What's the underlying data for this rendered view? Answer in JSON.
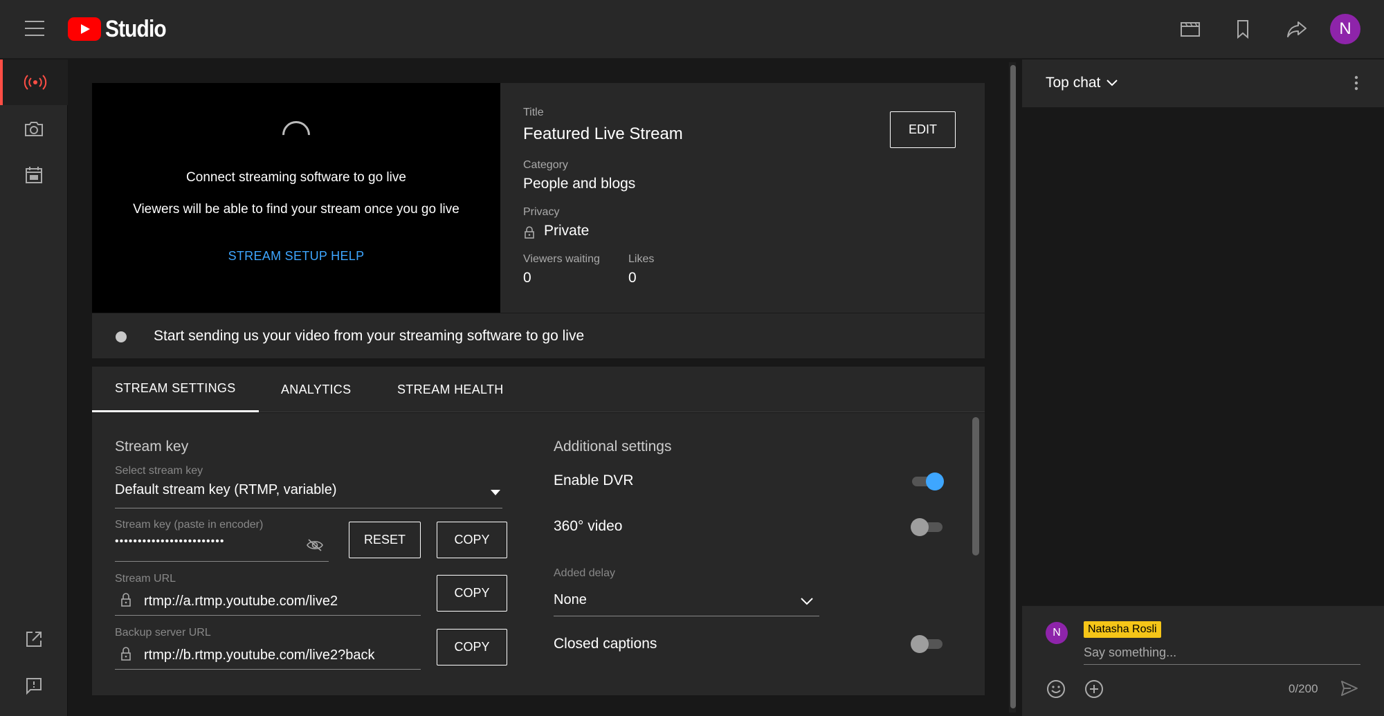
{
  "header": {
    "logo_text": "Studio",
    "avatar_letter": "N",
    "icons": [
      "menu-icon",
      "clapperboard-icon",
      "bookmark-icon",
      "share-icon"
    ]
  },
  "rail": {
    "items": [
      {
        "icon": "live-broadcast-icon",
        "active": true
      },
      {
        "icon": "camera-icon",
        "active": false
      },
      {
        "icon": "calendar-icon",
        "active": false
      },
      {
        "icon": "external-link-icon",
        "active": false
      },
      {
        "icon": "feedback-icon",
        "active": false
      }
    ]
  },
  "preview": {
    "line1": "Connect streaming software to go live",
    "line2": "Viewers will be able to find your stream once you go live",
    "help_link": "STREAM SETUP HELP"
  },
  "info": {
    "title_label": "Title",
    "title_value": "Featured Live Stream",
    "edit_button": "EDIT",
    "category_label": "Category",
    "category_value": "People and blogs",
    "privacy_label": "Privacy",
    "privacy_value": "Private",
    "viewers_label": "Viewers waiting",
    "viewers_value": "0",
    "likes_label": "Likes",
    "likes_value": "0"
  },
  "status": {
    "text": "Start sending us your video from your streaming software to go live"
  },
  "tabs": [
    {
      "label": "STREAM SETTINGS",
      "active": true
    },
    {
      "label": "ANALYTICS",
      "active": false
    },
    {
      "label": "STREAM HEALTH",
      "active": false
    }
  ],
  "stream_key": {
    "section_title": "Stream key",
    "select_label": "Select stream key",
    "select_value": "Default stream key (RTMP, variable)",
    "key_label": "Stream key (paste in encoder)",
    "key_value": "••••••••••••••••••••••••",
    "reset_button": "RESET",
    "copy_button": "COPY",
    "url_label": "Stream URL",
    "url_value": "rtmp://a.rtmp.youtube.com/live2",
    "backup_label": "Backup server URL",
    "backup_value": "rtmp://b.rtmp.youtube.com/live2?back"
  },
  "additional": {
    "section_title": "Additional settings",
    "dvr_label": "Enable DVR",
    "dvr_on": true,
    "video360_label": "360° video",
    "video360_on": false,
    "delay_label": "Added delay",
    "delay_value": "None",
    "captions_label": "Closed captions",
    "captions_on": false
  },
  "chat": {
    "title": "Top chat",
    "user_name": "Natasha Rosli",
    "user_initial": "N",
    "placeholder": "Say something...",
    "counter": "0/200"
  },
  "colors": {
    "accent_red": "#ff0000",
    "link_blue": "#3ea6ff",
    "toggle_on": "#3ea6ff",
    "avatar": "#8e24aa",
    "name_chip": "#f5c518"
  }
}
